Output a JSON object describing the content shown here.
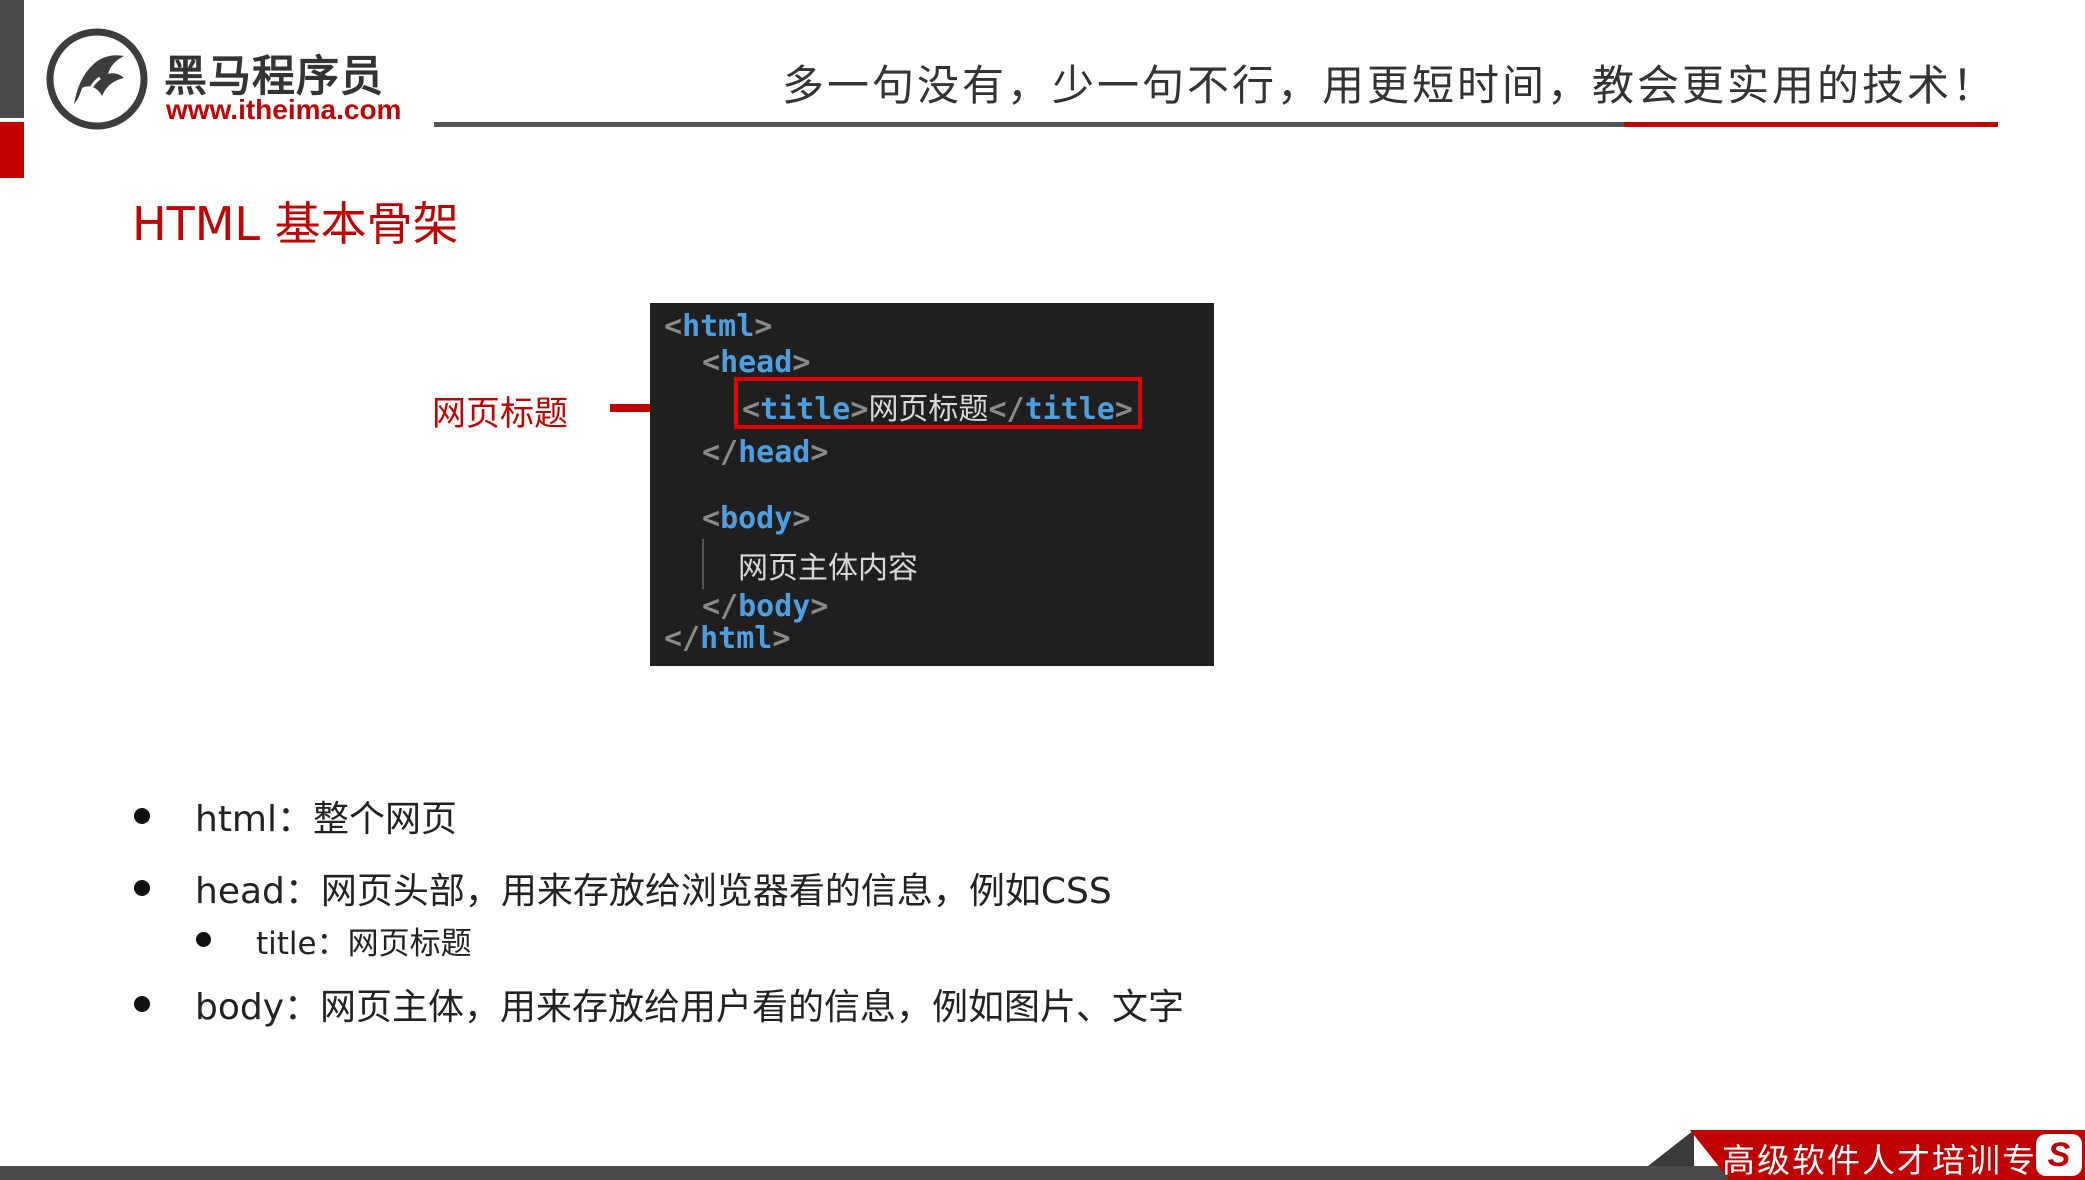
{
  "brand": {
    "name": "黑马程序员",
    "url": "www.itheima.com",
    "slogan": "多一句没有，少一句不行，用更短时间，教会更实用的技术！",
    "footer_tagline": "高级软件人才培训专",
    "footer_mark": "S",
    "colors": {
      "accent": "#c00000",
      "dark": "#4a4a4a",
      "code_bg": "#1f1f1f",
      "code_tag": "#4f9fe0"
    }
  },
  "slide": {
    "title": "HTML 基本骨架"
  },
  "annotation": {
    "label": "网页标题",
    "arrow_icon": "arrow-right-icon"
  },
  "code": {
    "lines": [
      {
        "open": "<",
        "tag": "html",
        "close": ">"
      },
      {
        "open": "<",
        "tag": "head",
        "close": ">"
      },
      {
        "open": "<",
        "tag": "title",
        "close": ">",
        "text": "网页标题",
        "end_open": "</",
        "end_tag": "title",
        "end_close": ">"
      },
      {
        "open": "</",
        "tag": "head",
        "close": ">"
      },
      {
        "open": "<",
        "tag": "body",
        "close": ">"
      },
      {
        "text": "网页主体内容"
      },
      {
        "open": "</",
        "tag": "body",
        "close": ">"
      },
      {
        "open": "</",
        "tag": "html",
        "close": ">"
      }
    ]
  },
  "bullets": [
    {
      "text": "html：整个网页"
    },
    {
      "text": "head：网页头部，用来存放给浏览器看的信息，例如CSS"
    },
    {
      "text": "title：网页标题"
    },
    {
      "text": "body：网页主体，用来存放给用户看的信息，例如图片、文字"
    }
  ]
}
